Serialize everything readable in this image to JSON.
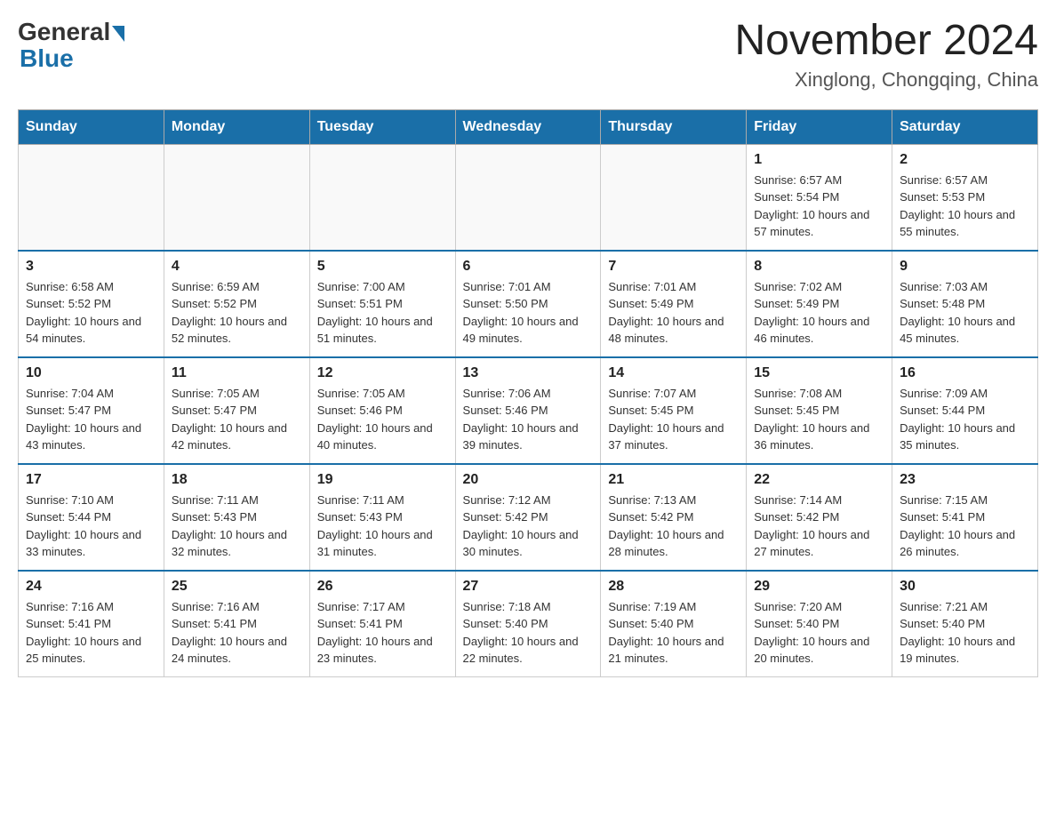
{
  "header": {
    "logo_general": "General",
    "logo_blue": "Blue",
    "month_year": "November 2024",
    "location": "Xinglong, Chongqing, China"
  },
  "weekdays": [
    "Sunday",
    "Monday",
    "Tuesday",
    "Wednesday",
    "Thursday",
    "Friday",
    "Saturday"
  ],
  "weeks": [
    [
      {
        "day": "",
        "info": ""
      },
      {
        "day": "",
        "info": ""
      },
      {
        "day": "",
        "info": ""
      },
      {
        "day": "",
        "info": ""
      },
      {
        "day": "",
        "info": ""
      },
      {
        "day": "1",
        "info": "Sunrise: 6:57 AM\nSunset: 5:54 PM\nDaylight: 10 hours and 57 minutes."
      },
      {
        "day": "2",
        "info": "Sunrise: 6:57 AM\nSunset: 5:53 PM\nDaylight: 10 hours and 55 minutes."
      }
    ],
    [
      {
        "day": "3",
        "info": "Sunrise: 6:58 AM\nSunset: 5:52 PM\nDaylight: 10 hours and 54 minutes."
      },
      {
        "day": "4",
        "info": "Sunrise: 6:59 AM\nSunset: 5:52 PM\nDaylight: 10 hours and 52 minutes."
      },
      {
        "day": "5",
        "info": "Sunrise: 7:00 AM\nSunset: 5:51 PM\nDaylight: 10 hours and 51 minutes."
      },
      {
        "day": "6",
        "info": "Sunrise: 7:01 AM\nSunset: 5:50 PM\nDaylight: 10 hours and 49 minutes."
      },
      {
        "day": "7",
        "info": "Sunrise: 7:01 AM\nSunset: 5:49 PM\nDaylight: 10 hours and 48 minutes."
      },
      {
        "day": "8",
        "info": "Sunrise: 7:02 AM\nSunset: 5:49 PM\nDaylight: 10 hours and 46 minutes."
      },
      {
        "day": "9",
        "info": "Sunrise: 7:03 AM\nSunset: 5:48 PM\nDaylight: 10 hours and 45 minutes."
      }
    ],
    [
      {
        "day": "10",
        "info": "Sunrise: 7:04 AM\nSunset: 5:47 PM\nDaylight: 10 hours and 43 minutes."
      },
      {
        "day": "11",
        "info": "Sunrise: 7:05 AM\nSunset: 5:47 PM\nDaylight: 10 hours and 42 minutes."
      },
      {
        "day": "12",
        "info": "Sunrise: 7:05 AM\nSunset: 5:46 PM\nDaylight: 10 hours and 40 minutes."
      },
      {
        "day": "13",
        "info": "Sunrise: 7:06 AM\nSunset: 5:46 PM\nDaylight: 10 hours and 39 minutes."
      },
      {
        "day": "14",
        "info": "Sunrise: 7:07 AM\nSunset: 5:45 PM\nDaylight: 10 hours and 37 minutes."
      },
      {
        "day": "15",
        "info": "Sunrise: 7:08 AM\nSunset: 5:45 PM\nDaylight: 10 hours and 36 minutes."
      },
      {
        "day": "16",
        "info": "Sunrise: 7:09 AM\nSunset: 5:44 PM\nDaylight: 10 hours and 35 minutes."
      }
    ],
    [
      {
        "day": "17",
        "info": "Sunrise: 7:10 AM\nSunset: 5:44 PM\nDaylight: 10 hours and 33 minutes."
      },
      {
        "day": "18",
        "info": "Sunrise: 7:11 AM\nSunset: 5:43 PM\nDaylight: 10 hours and 32 minutes."
      },
      {
        "day": "19",
        "info": "Sunrise: 7:11 AM\nSunset: 5:43 PM\nDaylight: 10 hours and 31 minutes."
      },
      {
        "day": "20",
        "info": "Sunrise: 7:12 AM\nSunset: 5:42 PM\nDaylight: 10 hours and 30 minutes."
      },
      {
        "day": "21",
        "info": "Sunrise: 7:13 AM\nSunset: 5:42 PM\nDaylight: 10 hours and 28 minutes."
      },
      {
        "day": "22",
        "info": "Sunrise: 7:14 AM\nSunset: 5:42 PM\nDaylight: 10 hours and 27 minutes."
      },
      {
        "day": "23",
        "info": "Sunrise: 7:15 AM\nSunset: 5:41 PM\nDaylight: 10 hours and 26 minutes."
      }
    ],
    [
      {
        "day": "24",
        "info": "Sunrise: 7:16 AM\nSunset: 5:41 PM\nDaylight: 10 hours and 25 minutes."
      },
      {
        "day": "25",
        "info": "Sunrise: 7:16 AM\nSunset: 5:41 PM\nDaylight: 10 hours and 24 minutes."
      },
      {
        "day": "26",
        "info": "Sunrise: 7:17 AM\nSunset: 5:41 PM\nDaylight: 10 hours and 23 minutes."
      },
      {
        "day": "27",
        "info": "Sunrise: 7:18 AM\nSunset: 5:40 PM\nDaylight: 10 hours and 22 minutes."
      },
      {
        "day": "28",
        "info": "Sunrise: 7:19 AM\nSunset: 5:40 PM\nDaylight: 10 hours and 21 minutes."
      },
      {
        "day": "29",
        "info": "Sunrise: 7:20 AM\nSunset: 5:40 PM\nDaylight: 10 hours and 20 minutes."
      },
      {
        "day": "30",
        "info": "Sunrise: 7:21 AM\nSunset: 5:40 PM\nDaylight: 10 hours and 19 minutes."
      }
    ]
  ]
}
